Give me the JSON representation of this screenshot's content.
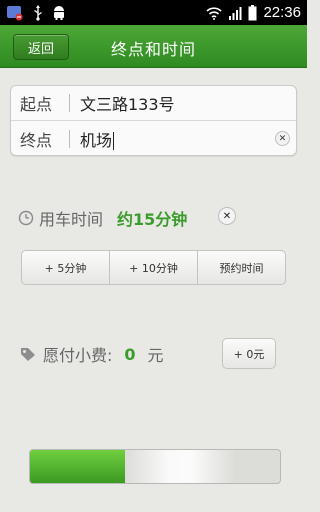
{
  "status_bar": {
    "time": "22:36",
    "left_icons": [
      "app-notification-icon",
      "usb-icon",
      "android-icon"
    ],
    "right_icons": [
      "wifi-icon",
      "signal-icon",
      "battery-icon"
    ]
  },
  "header": {
    "back_label": "返回",
    "title": "终点和时间"
  },
  "route": {
    "start_label": "起点",
    "start_value": "文三路133号",
    "end_label": "终点",
    "end_value": "机场"
  },
  "time": {
    "label": "用车时间",
    "value": "约15分钟"
  },
  "time_options": [
    "+ 5分钟",
    "+ 10分钟",
    "预约时间"
  ],
  "tip": {
    "label": "愿付小费:",
    "amount": "0",
    "unit": "元",
    "button_label": "+ 0元"
  },
  "slider": {
    "label": "",
    "progress": 0.38
  },
  "colors": {
    "accent": "#3a9c2a",
    "header": "#3b9a2a",
    "background": "#e8e8e5"
  }
}
